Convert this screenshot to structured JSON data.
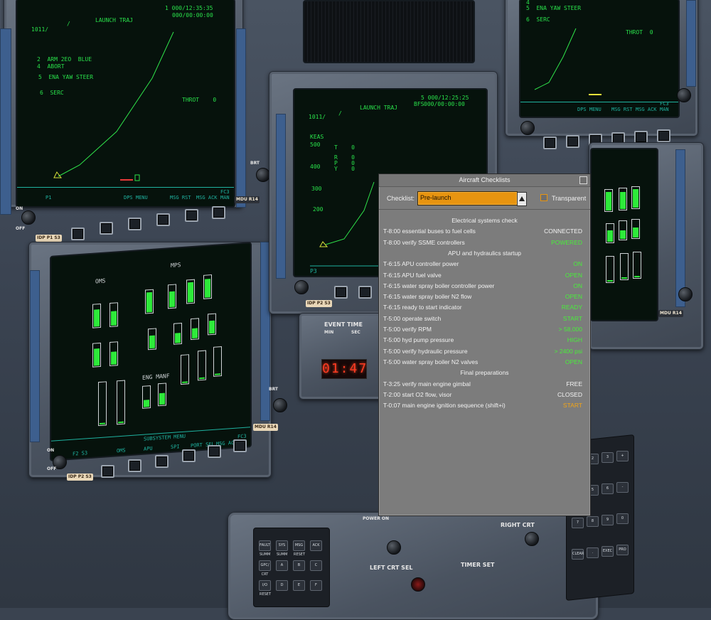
{
  "dialog": {
    "title": "Aircraft Checklists",
    "checklist_label": "Checklist:",
    "checklist_selected": "Pre-launch",
    "transparent_label": "Transparent"
  },
  "checklist": {
    "sections": [
      {
        "title": "Electrical systems check",
        "items": [
          {
            "name": "T-8:00 essential buses to fuel cells",
            "state": "CONNECTED",
            "color": "#f2f2f2"
          },
          {
            "name": "T-8:00 verify SSME controllers",
            "state": "POWERED",
            "color": "#48ee3a"
          }
        ]
      },
      {
        "title": "APU and hydraulics startup",
        "items": [
          {
            "name": "T-6:15 APU controller power",
            "state": "ON",
            "color": "#48ee3a"
          },
          {
            "name": "T-6:15 APU fuel valve",
            "state": "OPEN",
            "color": "#48ee3a"
          },
          {
            "name": "T-6:15 water spray boiler controller power",
            "state": "ON",
            "color": "#48ee3a"
          },
          {
            "name": "T-6:15 water spray boiler N2 flow",
            "state": "OPEN",
            "color": "#48ee3a"
          },
          {
            "name": "T-6:15 ready to start indicator",
            "state": "READY",
            "color": "#48ee3a"
          },
          {
            "name": "T-5:00 operate switch",
            "state": "START",
            "color": "#48ee3a"
          },
          {
            "name": "T-5:00 verify RPM",
            "state": "> 58,000",
            "color": "#48ee3a"
          },
          {
            "name": "T-5:00 hyd pump pressure",
            "state": "HIGH",
            "color": "#48ee3a"
          },
          {
            "name": "T-5:00 verify hydraulic pressure",
            "state": "> 2400 psi",
            "color": "#48ee3a"
          },
          {
            "name": "T-5:00 water spray boiler N2 valves",
            "state": "OPEN",
            "color": "#48ee3a"
          }
        ]
      },
      {
        "title": "Final preparations",
        "items": [
          {
            "name": "T-3:25 verify main engine gimbal",
            "state": "FREE",
            "color": "#f2f2f2"
          },
          {
            "name": "T-2:00 start O2 flow, visor",
            "state": "CLOSED",
            "color": "#f2f2f2"
          },
          {
            "name": "T-0:07 main engine ignition sequence (shift+i)",
            "state": "START",
            "color": "#f2a416"
          }
        ]
      }
    ]
  },
  "crt_left_top": {
    "id": "1011/",
    "slash": "/",
    "title": "LAUNCH TRAJ",
    "time_1": "1 000/12:35:35",
    "time_2": "000/00:00:00",
    "line_2": "2  ARM 2EO  BLUE",
    "line_4": "4  ABORT",
    "line_5": "5  ENA YAW STEER",
    "line_6": "6  SERC",
    "throt": "THROT    0",
    "menu_center": "DPS MENU",
    "menu_msg_rst": "MSG RST",
    "menu_msg_ack": "MSG ACK",
    "menu_fc": "FC3 MAN",
    "p_label": "P1"
  },
  "crt_center": {
    "id": "1011/",
    "slash": "/",
    "title": "LAUNCH TRAJ",
    "bfs": "BFS",
    "time_1": "5 000/12:25:25",
    "time_2": "000/00:00:00",
    "keas": "KEAS",
    "y500a": "500",
    "y400": "400",
    "y300": "300",
    "y200": "200",
    "t_label": "T    0",
    "r_label": "R    0",
    "p_label_att": "P    0",
    "y_label": "Y    0",
    "p_label": "P3"
  },
  "crt_right_top": {
    "line_4": "4",
    "line_5": "5  ENA YAW STEER",
    "line_6": "6  SERC",
    "throt": "THROT  0",
    "menu_dps": "DPS MENU",
    "menu_msg_rst": "MSG RST",
    "menu_msg_ack": "MSG ACK",
    "menu_fc": "FC3 MAN"
  },
  "crt_left_bottom": {
    "oms": "OMS",
    "mps": "MPS",
    "menu_subsystem": "SUBSYSTEM MENU",
    "menu_oms": "OMS",
    "menu_apu": "APU",
    "menu_spi": "SPI",
    "menu_port_sel": "PORT SEL",
    "menu_msg_ack": "MSG ACK",
    "menu_fc": "FC3 MAN",
    "p_label": "F2 S3",
    "eng_manf": "ENG MANF"
  },
  "tags": {
    "idp1": "IDP P1 S3",
    "idp2": "IDP P2 S3",
    "idp2b": "IDP P2 S3",
    "mdu1": "MDU R14",
    "mdu2": "MDU R14",
    "mdu3": "MDU R14",
    "event_time": "EVENT TIME",
    "event_min": "MIN",
    "event_sec": "SEC",
    "timer": "01:47",
    "off1": "OFF",
    "on1": "ON",
    "off2": "OFF",
    "on2": "ON",
    "brt1": "BRT",
    "brt2": "BRT",
    "left_crt_sel": "LEFT CRT SEL",
    "right_crt": "RIGHT CRT",
    "timer_set": "TIMER SET",
    "power_on": "POWER ON"
  },
  "keypad_left": [
    "FAULT SUMM",
    "SYS SUMM",
    "MSG RESET",
    "ACK",
    "GPC/ CRT",
    "A",
    "B",
    "C",
    "I/O RESET",
    "D",
    "E",
    "F"
  ],
  "keypad_right": [
    "1",
    "2",
    "3",
    "+",
    "4",
    "5",
    "6",
    "-",
    "7",
    "8",
    "9",
    "0",
    "CLEAR",
    ".",
    "EXEC",
    "PRO"
  ]
}
